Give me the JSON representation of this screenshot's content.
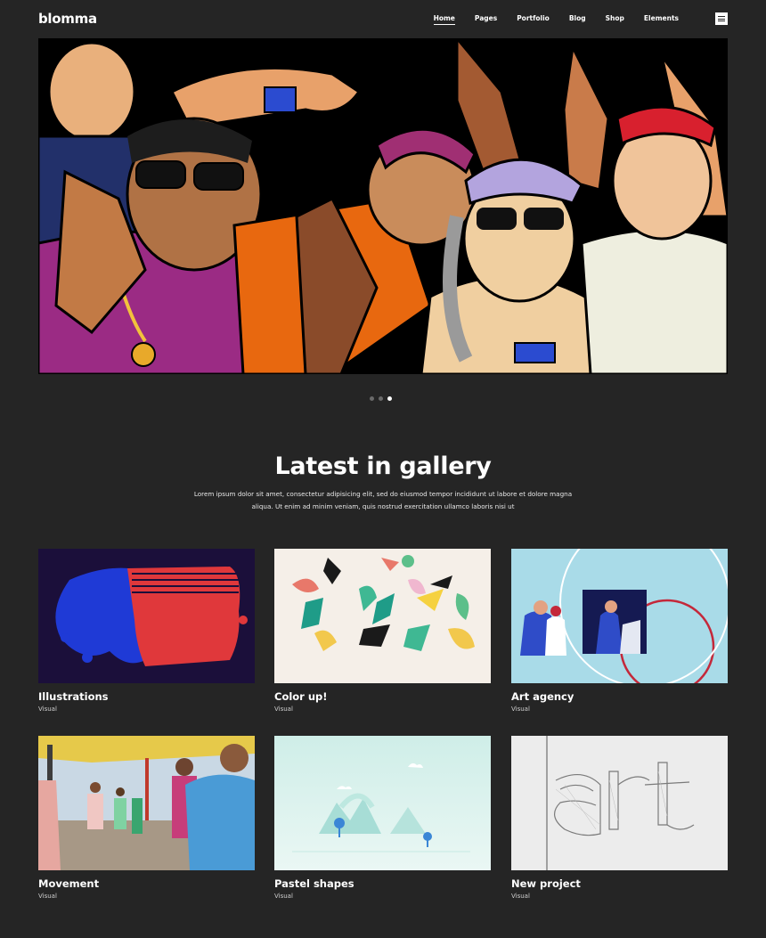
{
  "header": {
    "logo": "blomma",
    "nav": [
      {
        "label": "Home",
        "active": true
      },
      {
        "label": "Pages",
        "active": false
      },
      {
        "label": "Portfolio",
        "active": false
      },
      {
        "label": "Blog",
        "active": false
      },
      {
        "label": "Shop",
        "active": false
      },
      {
        "label": "Elements",
        "active": false
      }
    ],
    "menu_icon": "hamburger-icon"
  },
  "slider": {
    "slides": 3,
    "active_slide": 3
  },
  "gallery": {
    "title": "Latest in gallery",
    "description": "Lorem ipsum dolor sit amet, consectetur adipisicing elit, sed do eiusmod tempor incididunt ut labore et dolore magna aliqua. Ut enim ad minim veniam, quis nostrud exercitation ullamco laboris nisi ut",
    "items": [
      {
        "title": "Illustrations",
        "category": "Visual"
      },
      {
        "title": "Color up!",
        "category": "Visual"
      },
      {
        "title": "Art agency",
        "category": "Visual"
      },
      {
        "title": "Movement",
        "category": "Visual"
      },
      {
        "title": "Pastel shapes",
        "category": "Visual"
      },
      {
        "title": "New project",
        "category": "Visual"
      }
    ]
  }
}
